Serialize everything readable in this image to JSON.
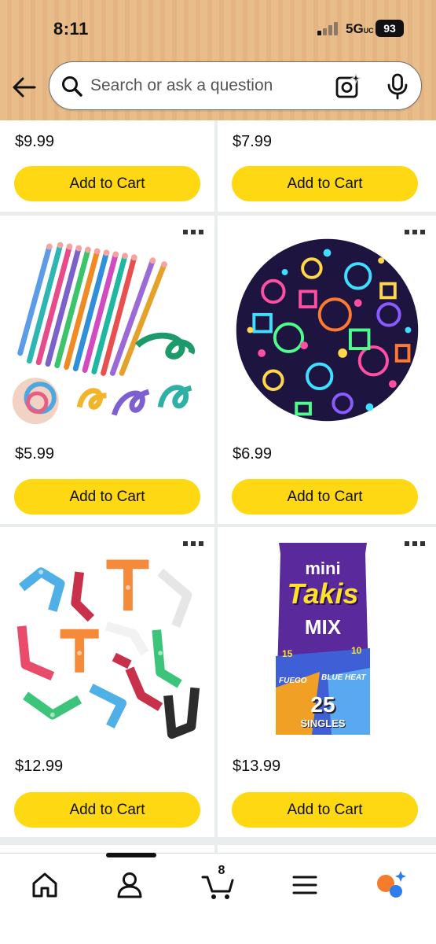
{
  "status_bar": {
    "time": "8:11",
    "network": "5G",
    "network_suffix": "UC",
    "battery": "93"
  },
  "search": {
    "placeholder": "Search or ask a question"
  },
  "icons": {
    "back": "arrow-left-icon",
    "search": "search-icon",
    "camera": "camera-icon",
    "mic": "microphone-icon",
    "more": "more-icon",
    "home": "home-icon",
    "account": "person-icon",
    "cart": "cart-icon",
    "menu": "menu-icon",
    "rufus": "rufus-icon"
  },
  "colors": {
    "add_to_cart": "#ffd814",
    "header": "#e9bd8a",
    "background": "#eaeded"
  },
  "products": [
    {
      "price": "$9.99",
      "button": "Add to Cart"
    },
    {
      "price": "$7.99",
      "button": "Add to Cart"
    },
    {
      "price": "$5.99",
      "button": "Add to Cart",
      "image": "bendy-pencils"
    },
    {
      "price": "$6.99",
      "button": "Add to Cart",
      "image": "neon-stickers"
    },
    {
      "price": "$12.99",
      "button": "Add to Cart",
      "image": "wacky-tracks"
    },
    {
      "price": "$13.99",
      "button": "Add to Cart",
      "image": "takis-pack",
      "packaging_text": {
        "mini": "mini",
        "brand": "Takis",
        "variant": "MIX",
        "count_left": "15",
        "count_right": "10",
        "flavor_left": "FUEGO",
        "flavor_right": "BLUE HEAT",
        "total": "25",
        "singles": "SINGLES"
      }
    }
  ],
  "bottom_nav": {
    "cart_count": "8"
  }
}
